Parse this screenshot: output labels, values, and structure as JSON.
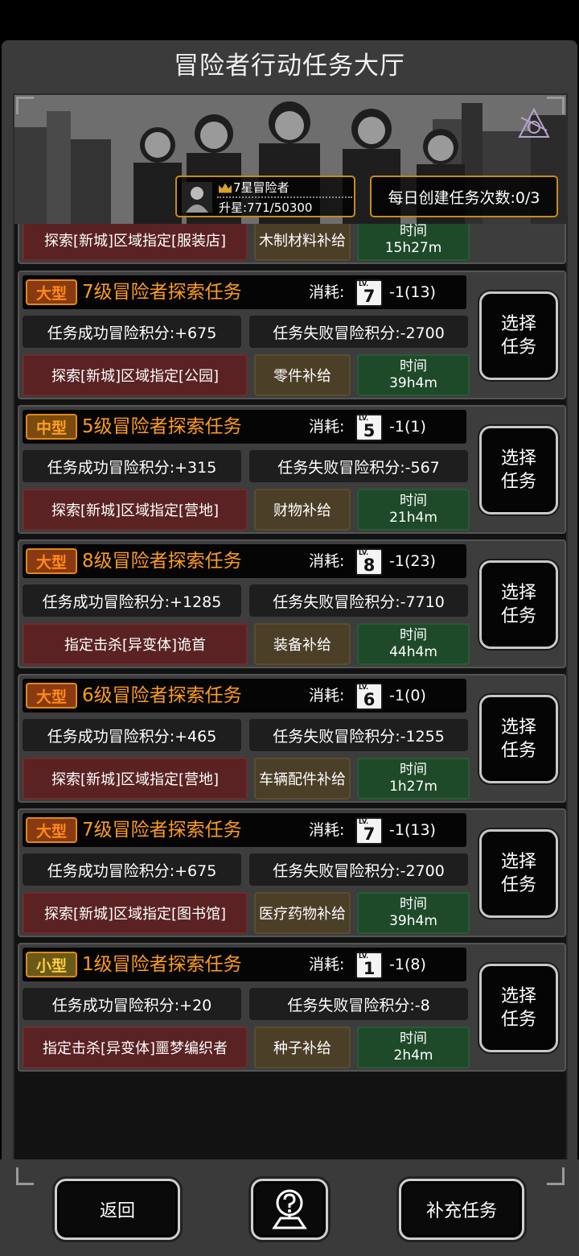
{
  "header": {
    "title": "冒险者行动任务大厅"
  },
  "banner": {
    "rank_title": "7星冒险者",
    "rank_progress": "升星:771/50300",
    "daily_create": "每日创建任务次数:0/3"
  },
  "labels": {
    "cost": "消耗:",
    "time": "时间",
    "select_line1": "选择",
    "select_line2": "任务",
    "lv": "LV."
  },
  "partial_task": {
    "target": "探索[新城]区域指定[服装店]",
    "supply": "木制材料补给",
    "time": "15h27m"
  },
  "tasks": [
    {
      "size": "大型",
      "title": "7级冒险者探索任务",
      "level": "7",
      "cost": "-1(13)",
      "success": "任务成功冒险积分:+675",
      "fail": "任务失败冒险积分:-2700",
      "target": "探索[新城]区域指定[公园]",
      "supply": "零件补给",
      "time": "39h4m"
    },
    {
      "size": "中型",
      "title": "5级冒险者探索任务",
      "level": "5",
      "cost": "-1(1)",
      "success": "任务成功冒险积分:+315",
      "fail": "任务失败冒险积分:-567",
      "target": "探索[新城]区域指定[营地]",
      "supply": "财物补给",
      "time": "21h4m"
    },
    {
      "size": "大型",
      "title": "8级冒险者探索任务",
      "level": "8",
      "cost": "-1(23)",
      "success": "任务成功冒险积分:+1285",
      "fail": "任务失败冒险积分:-7710",
      "target": "指定击杀[异变体]诡首",
      "supply": "装备补给",
      "time": "44h4m"
    },
    {
      "size": "大型",
      "title": "6级冒险者探索任务",
      "level": "6",
      "cost": "-1(0)",
      "success": "任务成功冒险积分:+465",
      "fail": "任务失败冒险积分:-1255",
      "target": "探索[新城]区域指定[营地]",
      "supply": "车辆配件补给",
      "time": "1h27m"
    },
    {
      "size": "大型",
      "title": "7级冒险者探索任务",
      "level": "7",
      "cost": "-1(13)",
      "success": "任务成功冒险积分:+675",
      "fail": "任务失败冒险积分:-2700",
      "target": "探索[新城]区域指定[图书馆]",
      "supply": "医疗药物补给",
      "time": "39h4m"
    },
    {
      "size": "小型",
      "title": "1级冒险者探索任务",
      "level": "1",
      "cost": "-1(8)",
      "success": "任务成功冒险积分:+20",
      "fail": "任务失败冒险积分:-8",
      "target": "指定击杀[异变体]噩梦编织者",
      "supply": "种子补给",
      "time": "2h4m"
    }
  ],
  "footer": {
    "back": "返回",
    "refill": "补充任务",
    "help_icon": "question-map-icon"
  },
  "colors": {
    "accent_orange": "#ff9c1e",
    "frame_gold": "#c98a1c",
    "target_red": "#5a2222",
    "time_green": "#1f4a2a",
    "supply_brown": "#4c3f28"
  }
}
